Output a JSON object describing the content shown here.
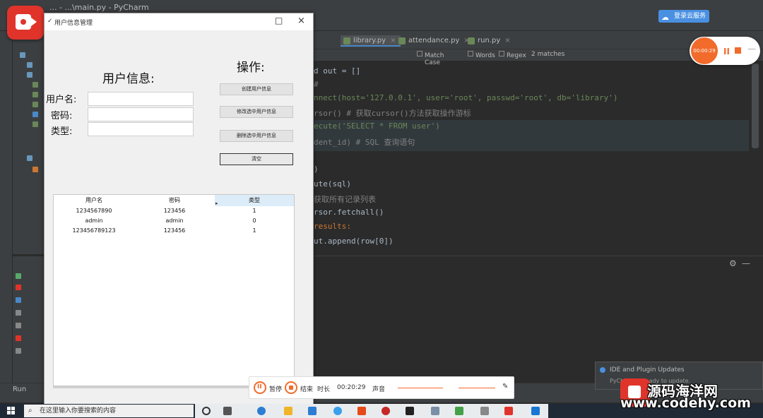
{
  "dialog": {
    "title": "用户信息管理",
    "title_icon": "✓",
    "minimize_glyph": "□",
    "close_glyph": "×",
    "heading_info": "用户信息:",
    "heading_ops": "操作:",
    "fields": [
      {
        "label": "用户名:",
        "value": ""
      },
      {
        "label": "密码:",
        "value": ""
      },
      {
        "label": "类型:",
        "value": ""
      }
    ],
    "buttons": [
      {
        "label": "创建用户信息"
      },
      {
        "label": "修改选中用户信息"
      },
      {
        "label": "删除选中用户信息"
      },
      {
        "label": "清空"
      }
    ],
    "table": {
      "headers": [
        "用户名",
        "密码",
        "类型"
      ],
      "selected_header": 2,
      "rows": [
        [
          "1234567890",
          "123456",
          "1"
        ],
        [
          "admin",
          "admin",
          "0"
        ],
        [
          "123456789123",
          "123456",
          "1"
        ]
      ],
      "arrow_glyph": "▸"
    }
  },
  "ide": {
    "titlebar_text": "... - ...\\main.py - PyCharm",
    "tabs": [
      {
        "label": "library.py",
        "active": true
      },
      {
        "label": "attendance.py",
        "active": false
      },
      {
        "label": "run.py",
        "active": false
      }
    ],
    "find_options": [
      "Match Case",
      "Words",
      "Regex"
    ],
    "find_result": "2 matches",
    "code_lines": [
      {
        "text": "d out = []",
        "cls": ""
      },
      {
        "text": "#",
        "cls": "cmt"
      },
      {
        "text": "nnect(host='127.0.0.1', user='root', passwd='root', db='library')",
        "cls": "str"
      },
      {
        "text": "rsor()  # 获取cursor()方法获取操作游标",
        "cls": "cmt"
      },
      {
        "text": "ecute('SELECT * FROM user')",
        "cls": "str"
      },
      {
        "text": "dent_id)  # SQL 查询语句",
        "cls": "cmt"
      },
      {
        "text": ")",
        "cls": ""
      },
      {
        "text": "ute(sql)",
        "cls": ""
      },
      {
        "text": "获取所有记录列表",
        "cls": "cmt"
      },
      {
        "text": "rsor.fetchall()",
        "cls": ""
      },
      {
        "text": "results:",
        "cls": "kw"
      },
      {
        "text": "ut.append(row[0])",
        "cls": ""
      }
    ],
    "cloud_button": "登录云服务",
    "run_tab": "Run",
    "gear_glyph": "⚙",
    "minus_glyph": "—"
  },
  "recorder": {
    "timer_text": "00:00:29",
    "pause_glyph": "II",
    "dash_glyph": "—",
    "bar": {
      "pause_label": "暂停",
      "stop_label": "结束",
      "time_label": "时长",
      "time": "00:20:29",
      "audio_label": "声音"
    }
  },
  "notification": {
    "title": "IDE and Plugin Updates",
    "subtitle": "PyCharm is ready to update."
  },
  "watermark": {
    "title": "源码海洋网",
    "url": "www.codehy.com"
  },
  "taskbar": {
    "search_placeholder": "在这里输入你要搜索的内容",
    "search_glyph": "⌕"
  }
}
